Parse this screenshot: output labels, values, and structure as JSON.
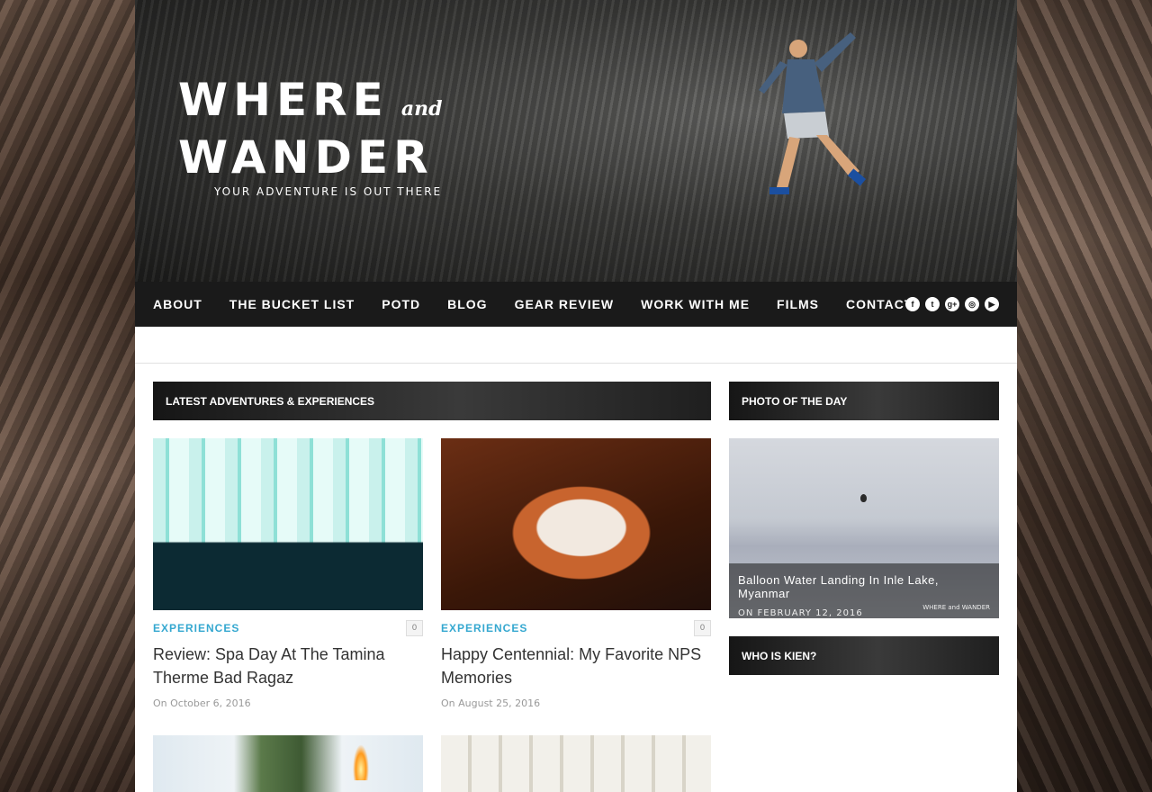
{
  "site": {
    "logo_line1": "WHERE",
    "logo_and": "and",
    "logo_line2": "WANDER",
    "tagline": "YOUR ADVENTURE IS OUT THERE"
  },
  "nav": {
    "items": [
      "ABOUT",
      "THE BUCKET LIST",
      "POTD",
      "BLOG",
      "GEAR REVIEW",
      "WORK WITH ME",
      "FILMS",
      "CONTACT"
    ],
    "social": [
      "facebook-icon",
      "twitter-icon",
      "google-plus-icon",
      "instagram-icon",
      "youtube-icon"
    ]
  },
  "latest": {
    "heading": "LATEST ADVENTURES & EXPERIENCES",
    "posts": [
      {
        "category": "EXPERIENCES",
        "comments": "0",
        "title": "Review: Spa Day At The Tamina Therme Bad Ragaz",
        "date": "On October 6, 2016"
      },
      {
        "category": "EXPERIENCES",
        "comments": "0",
        "title": "Happy Centennial: My Favorite NPS Memories",
        "date": "On August 25, 2016"
      }
    ]
  },
  "potd": {
    "heading": "PHOTO OF THE DAY",
    "caption_title": "Balloon Water Landing In Inle Lake, Myanmar",
    "caption_date": "ON FEBRUARY 12, 2016",
    "watermark": "WHERE and WANDER"
  },
  "kien": {
    "heading": "WHO IS KIEN?"
  },
  "colors": {
    "accent": "#35a8d0",
    "nav_bg": "#1a1a1a"
  }
}
